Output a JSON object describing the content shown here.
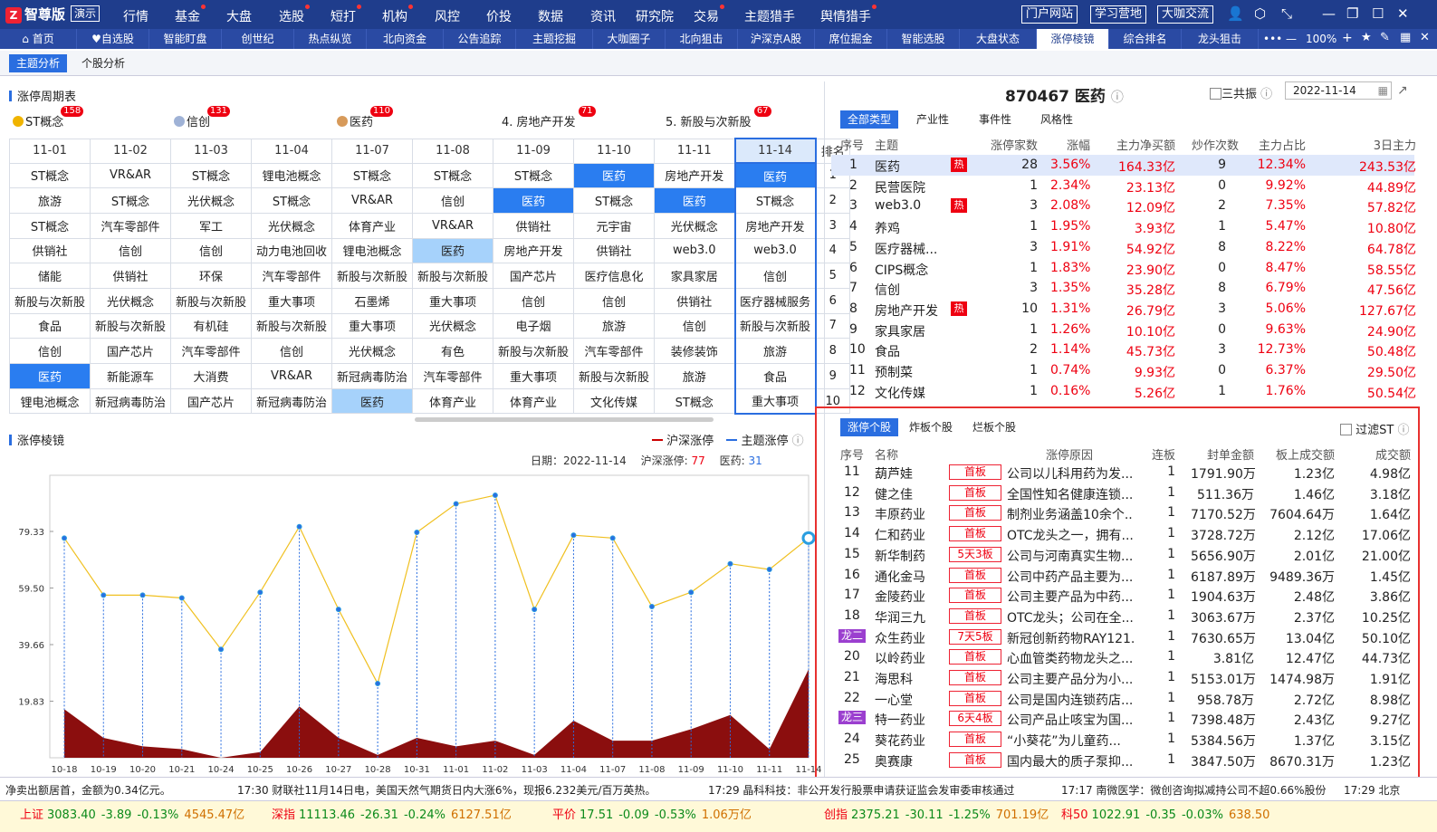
{
  "app": {
    "logo_badge": "Z",
    "logo": "智尊版",
    "demo": "演示"
  },
  "menu": [
    {
      "label": "行情",
      "dot": false
    },
    {
      "label": "基金",
      "dot": true
    },
    {
      "label": "大盘",
      "dot": false
    },
    {
      "label": "选股",
      "dot": true
    },
    {
      "label": "短打",
      "dot": true
    },
    {
      "label": "机构",
      "dot": true
    },
    {
      "label": "风控",
      "dot": false
    },
    {
      "label": "价投",
      "dot": false
    },
    {
      "label": "数据",
      "dot": false
    },
    {
      "label": "资讯",
      "dot": false
    },
    {
      "label": "研究院",
      "dot": false
    },
    {
      "label": "交易",
      "dot": true
    },
    {
      "label": "主题猎手",
      "dot": false
    },
    {
      "label": "舆情猎手",
      "dot": true
    }
  ],
  "top_buttons": [
    "门户网站",
    "学习营地",
    "大咖交流"
  ],
  "tabs": [
    "首页",
    "自选股",
    "智能盯盘",
    "创世纪",
    "热点纵览",
    "北向资金",
    "公告追踪",
    "主题挖掘",
    "大咖圈子",
    "北向狙击",
    "沪深京A股",
    "席位掘金",
    "智能选股",
    "大盘状态",
    "涨停棱镜",
    "综合排名",
    "龙头狙击"
  ],
  "tab_right": {
    "more": "•••",
    "zoom": "100%"
  },
  "subtabs": [
    "主题分析",
    "个股分析"
  ],
  "cycle": {
    "title": "涨停周期表",
    "heads": [
      {
        "label": "ST概念",
        "count": "158",
        "medal": "1"
      },
      {
        "label": "信创",
        "count": "131",
        "medal": "2"
      },
      {
        "label": "医药",
        "count": "110",
        "medal": "3"
      },
      {
        "label": "4. 房地产开发",
        "count": "71",
        "medal": ""
      },
      {
        "label": "5. 新股与次新股",
        "count": "67",
        "medal": ""
      }
    ],
    "dates": [
      "11-01",
      "11-02",
      "11-03",
      "11-04",
      "11-07",
      "11-08",
      "11-09",
      "11-10",
      "11-11",
      "11-14"
    ],
    "rank_label": "排名",
    "rows": [
      {
        "rank": "1",
        "cells": [
          "ST概念",
          "VR&AR",
          "ST概念",
          "锂电池概念",
          "ST概念",
          "ST概念",
          "ST概念",
          "医药",
          "房地产开发",
          "医药"
        ]
      },
      {
        "rank": "2",
        "cells": [
          "旅游",
          "ST概念",
          "光伏概念",
          "ST概念",
          "VR&AR",
          "信创",
          "医药",
          "ST概念",
          "医药",
          "ST概念"
        ]
      },
      {
        "rank": "3",
        "cells": [
          "ST概念",
          "汽车零部件",
          "军工",
          "光伏概念",
          "体育产业",
          "VR&AR",
          "供销社",
          "元宇宙",
          "光伏概念",
          "房地产开发"
        ]
      },
      {
        "rank": "4",
        "cells": [
          "供销社",
          "信创",
          "信创",
          "动力电池回收",
          "锂电池概念",
          "医药",
          "房地产开发",
          "供销社",
          "web3.0",
          "web3.0"
        ]
      },
      {
        "rank": "5",
        "cells": [
          "储能",
          "供销社",
          "环保",
          "汽车零部件",
          "新股与次新股",
          "新股与次新股",
          "国产芯片",
          "医疗信息化",
          "家具家居",
          "信创"
        ]
      },
      {
        "rank": "6",
        "cells": [
          "新股与次新股",
          "光伏概念",
          "新股与次新股",
          "重大事项",
          "石墨烯",
          "重大事项",
          "信创",
          "信创",
          "供销社",
          "医疗器械服务"
        ]
      },
      {
        "rank": "7",
        "cells": [
          "食品",
          "新股与次新股",
          "有机硅",
          "新股与次新股",
          "重大事项",
          "光伏概念",
          "电子烟",
          "旅游",
          "信创",
          "新股与次新股"
        ]
      },
      {
        "rank": "8",
        "cells": [
          "信创",
          "国产芯片",
          "汽车零部件",
          "信创",
          "光伏概念",
          "有色",
          "新股与次新股",
          "汽车零部件",
          "装修装饰",
          "旅游"
        ]
      },
      {
        "rank": "9",
        "cells": [
          "医药",
          "新能源车",
          "大消费",
          "VR&AR",
          "新冠病毒防治",
          "汽车零部件",
          "重大事项",
          "新股与次新股",
          "旅游",
          "食品"
        ]
      },
      {
        "rank": "10",
        "cells": [
          "锂电池概念",
          "新冠病毒防治",
          "国产芯片",
          "新冠病毒防治",
          "医药",
          "体育产业",
          "体育产业",
          "文化传媒",
          "ST概念",
          "重大事项"
        ]
      }
    ]
  },
  "chart_title": "涨停棱镜",
  "chart_legend": {
    "a": "沪深涨停",
    "b": "主题涨停"
  },
  "chart_info": {
    "date_label": "日期：",
    "date": "2022-11-14",
    "hs_label": "沪深涨停:",
    "hs": "77",
    "yy_label": "医药:",
    "yy": "31"
  },
  "chart_data": {
    "type": "line",
    "x": [
      "10-18",
      "10-19",
      "10-20",
      "10-21",
      "10-24",
      "10-25",
      "10-26",
      "10-27",
      "10-28",
      "10-31",
      "11-01",
      "11-02",
      "11-03",
      "11-04",
      "11-07",
      "11-08",
      "11-09",
      "11-10",
      "11-11",
      "11-14"
    ],
    "yticks": [
      "19.83",
      "39.66",
      "59.50",
      "79.33"
    ],
    "ylim": [
      0,
      99
    ],
    "series": [
      {
        "name": "沪深涨停",
        "values": [
          77,
          57,
          57,
          56,
          38,
          58,
          81,
          52,
          26,
          79,
          89,
          92,
          52,
          78,
          77,
          53,
          58,
          68,
          66,
          77
        ]
      },
      {
        "name": "主题涨停",
        "values": [
          17,
          7,
          4,
          3,
          0,
          2,
          18,
          7,
          1,
          7,
          4,
          6,
          1,
          13,
          6,
          6,
          10,
          15,
          3,
          31
        ]
      }
    ]
  },
  "right_panel": {
    "code": "870467",
    "name": "医药",
    "sangong": "三共振",
    "date": "2022-11-14",
    "types": [
      "全部类型",
      "产业性",
      "事件性",
      "风格性"
    ],
    "head": [
      "序号",
      "主题",
      "涨停家数",
      "涨幅",
      "主力净买额",
      "炒作次数",
      "主力占比",
      "3日主力"
    ],
    "hot": "热",
    "rows": [
      [
        "1",
        "医药",
        "28",
        "3.56%",
        "164.33亿",
        "9",
        "12.34%",
        "243.53亿",
        "1"
      ],
      [
        "2",
        "民营医院",
        "1",
        "2.34%",
        "23.13亿",
        "0",
        "9.92%",
        "44.89亿",
        "0"
      ],
      [
        "3",
        "web3.0",
        "3",
        "2.08%",
        "12.09亿",
        "2",
        "7.35%",
        "57.82亿",
        "1"
      ],
      [
        "4",
        "养鸡",
        "1",
        "1.95%",
        "3.93亿",
        "1",
        "5.47%",
        "10.80亿",
        "0"
      ],
      [
        "5",
        "医疗器械...",
        "3",
        "1.91%",
        "54.92亿",
        "8",
        "8.22%",
        "64.78亿",
        "0"
      ],
      [
        "6",
        "CIPS概念",
        "1",
        "1.83%",
        "23.90亿",
        "0",
        "8.47%",
        "58.55亿",
        "0"
      ],
      [
        "7",
        "信创",
        "3",
        "1.35%",
        "35.28亿",
        "8",
        "6.79%",
        "47.56亿",
        "0"
      ],
      [
        "8",
        "房地产开发",
        "10",
        "1.31%",
        "26.79亿",
        "3",
        "5.06%",
        "127.67亿",
        "1"
      ],
      [
        "9",
        "家具家居",
        "1",
        "1.26%",
        "10.10亿",
        "0",
        "9.63%",
        "24.90亿",
        "0"
      ],
      [
        "10",
        "食品",
        "2",
        "1.14%",
        "45.73亿",
        "3",
        "12.73%",
        "50.48亿",
        "0"
      ],
      [
        "11",
        "预制菜",
        "1",
        "0.74%",
        "9.93亿",
        "0",
        "6.37%",
        "29.50亿",
        "0"
      ],
      [
        "12",
        "文化传媒",
        "1",
        "0.16%",
        "5.26亿",
        "1",
        "1.76%",
        "50.54亿",
        "0"
      ]
    ]
  },
  "stocks": {
    "tabs": [
      "涨停个股",
      "炸板个股",
      "烂板个股"
    ],
    "filter": "过滤ST",
    "head": [
      "序号",
      "名称",
      "涨停原因",
      "连板",
      "封单金额",
      "板上成交额",
      "成交额"
    ],
    "rows": [
      {
        "no": "11",
        "dragon": "",
        "name": "葫芦娃",
        "tag": "首板",
        "reason": "公司以儿科用药为发...",
        "lb": "1",
        "fd": "1791.90万",
        "bs": "1.23亿",
        "cj": "4.98亿"
      },
      {
        "no": "12",
        "dragon": "",
        "name": "健之佳",
        "tag": "首板",
        "reason": "全国性知名健康连锁...",
        "lb": "1",
        "fd": "511.36万",
        "bs": "1.46亿",
        "cj": "3.18亿"
      },
      {
        "no": "13",
        "dragon": "",
        "name": "丰原药业",
        "tag": "首板",
        "reason": "制剂业务涵盖10余个...",
        "lb": "1",
        "fd": "7170.52万",
        "bs": "7604.64万",
        "cj": "1.64亿"
      },
      {
        "no": "14",
        "dragon": "",
        "name": "仁和药业",
        "tag": "首板",
        "reason": "OTC龙头之一，拥有...",
        "lb": "1",
        "fd": "3728.72万",
        "bs": "2.12亿",
        "cj": "17.06亿"
      },
      {
        "no": "15",
        "dragon": "",
        "name": "新华制药",
        "tag": "5天3板",
        "reason": "公司与河南真实生物...",
        "lb": "1",
        "fd": "5656.90万",
        "bs": "2.01亿",
        "cj": "21.00亿"
      },
      {
        "no": "16",
        "dragon": "",
        "name": "通化金马",
        "tag": "首板",
        "reason": "公司中药产品主要为...",
        "lb": "1",
        "fd": "6187.89万",
        "bs": "9489.36万",
        "cj": "1.45亿"
      },
      {
        "no": "17",
        "dragon": "",
        "name": "金陵药业",
        "tag": "首板",
        "reason": "公司主要产品为中药...",
        "lb": "1",
        "fd": "1904.63万",
        "bs": "2.48亿",
        "cj": "3.86亿"
      },
      {
        "no": "18",
        "dragon": "",
        "name": "华润三九",
        "tag": "首板",
        "reason": "OTC龙头；公司在全...",
        "lb": "1",
        "fd": "3063.67万",
        "bs": "2.37亿",
        "cj": "10.25亿"
      },
      {
        "no": "",
        "dragon": "龙二",
        "name": "众生药业",
        "tag": "7天5板",
        "reason": "新冠创新药物RAY121...",
        "lb": "1",
        "fd": "7630.65万",
        "bs": "13.04亿",
        "cj": "50.10亿"
      },
      {
        "no": "20",
        "dragon": "",
        "name": "以岭药业",
        "tag": "首板",
        "reason": "心血管类药物龙头之...",
        "lb": "1",
        "fd": "3.81亿",
        "bs": "12.47亿",
        "cj": "44.73亿"
      },
      {
        "no": "21",
        "dragon": "",
        "name": "海思科",
        "tag": "首板",
        "reason": "公司主要产品分为小...",
        "lb": "1",
        "fd": "5153.01万",
        "bs": "1474.98万",
        "cj": "1.91亿"
      },
      {
        "no": "22",
        "dragon": "",
        "name": "一心堂",
        "tag": "首板",
        "reason": "公司是国内连锁药店...",
        "lb": "1",
        "fd": "958.78万",
        "bs": "2.72亿",
        "cj": "8.98亿"
      },
      {
        "no": "",
        "dragon": "龙三",
        "name": "特一药业",
        "tag": "6天4板",
        "reason": "公司产品止咳宝为国...",
        "lb": "1",
        "fd": "7398.48万",
        "bs": "2.43亿",
        "cj": "9.27亿"
      },
      {
        "no": "24",
        "dragon": "",
        "name": "葵花药业",
        "tag": "首板",
        "reason": "“小葵花”为儿童药...",
        "lb": "1",
        "fd": "5384.56万",
        "bs": "1.37亿",
        "cj": "3.15亿"
      },
      {
        "no": "25",
        "dragon": "",
        "name": "奥赛康",
        "tag": "首板",
        "reason": "国内最大的质子泵抑...",
        "lb": "1",
        "fd": "3847.50万",
        "bs": "8670.31万",
        "cj": "1.23亿"
      }
    ]
  },
  "news": [
    "净卖出额居首，金额为0.34亿元。",
    "17:30 财联社11月14日电，美国天然气期货日内大涨6%，现报6.232美元/百万英热。",
    "17:29 晶科科技：非公开发行股票申请获证监会发审委审核通过",
    "17:17 南微医学：微创咨询拟减持公司不超0.66%股份",
    "17:29 北京"
  ],
  "indices": [
    {
      "name": "上证",
      "v": "3083.40",
      "c": "-3.89",
      "p": "-0.13%",
      "a": "4545.47亿"
    },
    {
      "name": "深指",
      "v": "11113.46",
      "c": "-26.31",
      "p": "-0.24%",
      "a": "6127.51亿"
    },
    {
      "name": "平价",
      "v": "17.51",
      "c": "-0.09",
      "p": "-0.53%",
      "a": "1.06万亿"
    },
    {
      "name": "创指",
      "v": "2375.21",
      "c": "-30.11",
      "p": "-1.25%",
      "a": "701.19亿"
    },
    {
      "name": "科50",
      "v": "1022.91",
      "c": "-0.35",
      "p": "-0.03%",
      "a": "638.50"
    }
  ]
}
